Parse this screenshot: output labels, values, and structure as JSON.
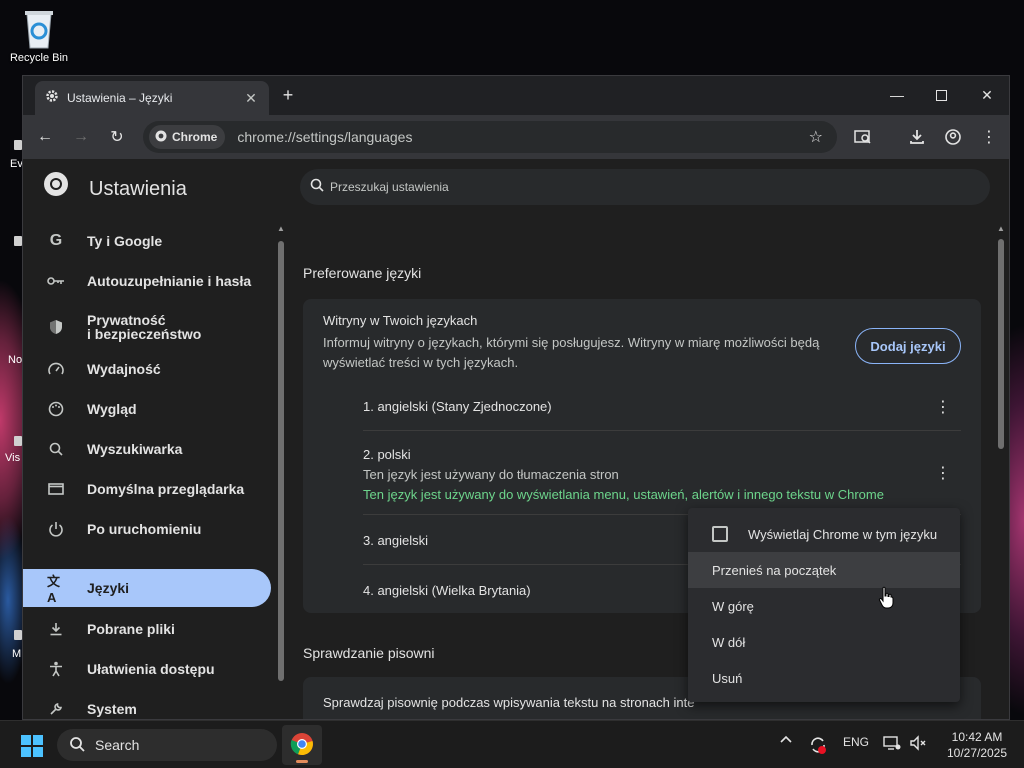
{
  "desktop": {
    "recycle_bin_label": "Recycle Bin",
    "edge_labels": [
      "Ev",
      "No",
      "Vis",
      "M"
    ]
  },
  "browser": {
    "tab_title": "Ustawienia – Języki",
    "chip_label": "Chrome",
    "url": "chrome://settings/languages"
  },
  "settings": {
    "title": "Ustawienia",
    "search_placeholder": "Przeszukaj ustawienia",
    "nav": [
      {
        "label": "Ty i Google",
        "icon": "google-icon"
      },
      {
        "label": "Autouzupełnianie i hasła",
        "icon": "key-icon"
      },
      {
        "label": "Prywatność\ni bezpieczeństwo",
        "icon": "shield-icon"
      },
      {
        "label": "Wydajność",
        "icon": "speedometer-icon"
      },
      {
        "label": "Wygląd",
        "icon": "palette-icon"
      },
      {
        "label": "Wyszukiwarka",
        "icon": "search-icon"
      },
      {
        "label": "Domyślna przeglądarka",
        "icon": "browser-window-icon"
      },
      {
        "label": "Po uruchomieniu",
        "icon": "power-icon"
      },
      {
        "label": "Języki",
        "icon": "translate-icon",
        "active": true
      },
      {
        "label": "Pobrane pliki",
        "icon": "download-icon"
      },
      {
        "label": "Ułatwienia dostępu",
        "icon": "accessibility-icon"
      },
      {
        "label": "System",
        "icon": "wrench-icon"
      }
    ],
    "preferred_section_title": "Preferowane języki",
    "preferred_card": {
      "heading": "Witryny w Twoich językach",
      "description": "Informuj witryny o językach, którymi się posługujesz. Witryny w miarę możliwości będą wyświetlać treści w tych językach.",
      "add_button": "Dodaj języki",
      "languages": [
        {
          "name": "1. angielski (Stany Zjednoczone)"
        },
        {
          "name": "2. polski",
          "note1": "Ten język jest używany do tłumaczenia stron",
          "note2": "Ten język jest używany do wyświetlania menu, ustawień, alertów i innego tekstu w Chrome"
        },
        {
          "name": "3. angielski"
        },
        {
          "name": "4. angielski (Wielka Brytania)"
        }
      ]
    },
    "spell_section_title": "Sprawdzanie pisowni",
    "spell_card_text": "Sprawdzaj pisownię podczas wpisywania tekstu na stronach inte"
  },
  "context_menu": {
    "items": [
      "Wyświetlaj Chrome w tym języku",
      "Przenieś na początek",
      "W górę",
      "W dół",
      "Usuń"
    ]
  },
  "taskbar": {
    "search_label": "Search",
    "language": "ENG",
    "time": "10:42 AM",
    "date": "10/27/2025"
  },
  "colors": {
    "accent": "#a8c7fa",
    "green_note": "#6dd58c",
    "page_bg": "#1f1f1f",
    "card_bg": "#282a2c"
  }
}
